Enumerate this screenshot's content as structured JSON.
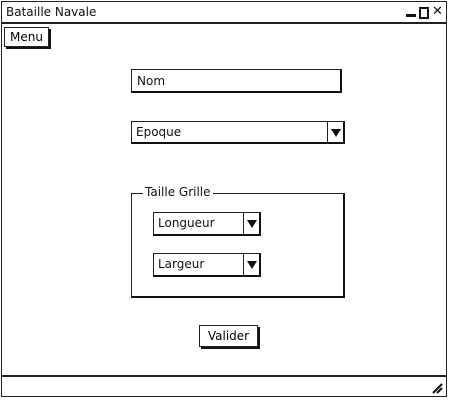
{
  "window": {
    "title": "Bataille Navale",
    "close_glyph": "✕"
  },
  "menu": {
    "label": "Menu"
  },
  "form": {
    "nom_placeholder": "Nom",
    "epoque_selected": "Epoque",
    "taille_grille_legend": "Taille Grille",
    "longueur_selected": "Longueur",
    "largeur_selected": "Largeur",
    "submit_label": "Valider"
  },
  "icons": {
    "minimize": "minimize-icon",
    "maximize": "maximize-icon",
    "close": "close-icon",
    "dropdown": "chevron-down-icon",
    "resize": "resize-grip-icon"
  },
  "colors": {
    "ink": "#111111",
    "background": "#ffffff"
  }
}
